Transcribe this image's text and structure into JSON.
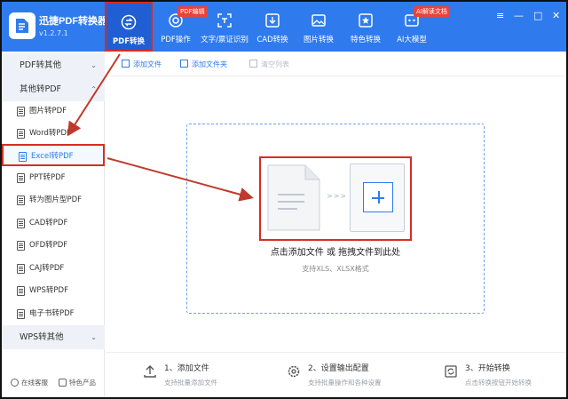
{
  "app": {
    "title": "迅捷PDF转换器",
    "version": "v1.2.7.1"
  },
  "tabs": [
    {
      "label": "PDF转换",
      "icon": "convert-icon"
    },
    {
      "label": "PDF操作",
      "icon": "target-icon"
    },
    {
      "label": "文字/票证识别",
      "icon": "scan-text-icon"
    },
    {
      "label": "CAD转换",
      "icon": "cad-icon"
    },
    {
      "label": "图片转换",
      "icon": "image-icon"
    },
    {
      "label": "特色转换",
      "icon": "star-box-icon"
    },
    {
      "label": "AI大模型",
      "icon": "ai-icon"
    }
  ],
  "badges": {
    "pdf_edit": "PDF编辑",
    "ai_doc": "AI解读文档"
  },
  "window_controls": {
    "minimize": "—",
    "maximize": "□",
    "close": "✕",
    "menu": "≡"
  },
  "sidebar": {
    "sections": [
      "PDF转其他",
      "其他转PDF",
      "WPS转其他"
    ],
    "items": [
      "图片转PDF",
      "Word转PDF",
      "Excel转PDF",
      "PPT转PDF",
      "转为图片型PDF",
      "CAD转PDF",
      "OFD转PDF",
      "CAJ转PDF",
      "WPS转PDF",
      "电子书转PDF"
    ],
    "selected": "Excel转PDF",
    "footer": {
      "support": "在线客服",
      "featured": "特色产品"
    }
  },
  "toolbar": {
    "add_file": "添加文件",
    "add_folder": "添加文件夹",
    "clear_list": "清空列表"
  },
  "dropzone": {
    "main": "点击添加文件 或 拖拽文件到此处",
    "sub": "支持XLS、XLSX格式",
    "arrows": ">>>"
  },
  "steps": [
    {
      "title": "1、添加文件",
      "sub": "支持批量添加文件"
    },
    {
      "title": "2、设置输出配置",
      "sub": "支持批量操作和各种设置"
    },
    {
      "title": "3、开始转换",
      "sub": "点击转换按钮开始转换"
    }
  ],
  "colors": {
    "brand": "#2f7bee",
    "active_tab": "#1f5fd3",
    "annotation": "#d62d24",
    "sidebar_section": "#eef2f8"
  }
}
